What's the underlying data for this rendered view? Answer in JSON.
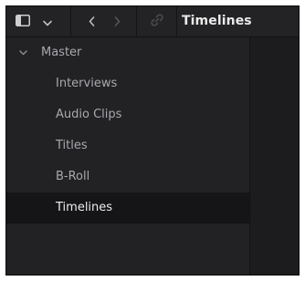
{
  "toolbar": {
    "sidebar_toggle_icon": "sidebar-toggle-icon",
    "dropdown_icon": "chevron-down-icon",
    "back_icon": "chevron-left-icon",
    "forward_icon": "chevron-right-icon",
    "link_icon": "link-icon",
    "current_bin": "Timelines"
  },
  "tree": {
    "root": {
      "label": "Master",
      "icon": "chevron-down-icon"
    },
    "bins": [
      {
        "label": "Interviews",
        "selected": false
      },
      {
        "label": "Audio Clips",
        "selected": false
      },
      {
        "label": "Titles",
        "selected": false
      },
      {
        "label": "B-Roll",
        "selected": false
      },
      {
        "label": "Timelines",
        "selected": true
      }
    ]
  },
  "colors": {
    "panel_bg": "#222225",
    "toolbar_bg": "#232326",
    "selected_row_bg": "#151517",
    "text": "#a9a9ad",
    "text_selected": "#ececee"
  }
}
